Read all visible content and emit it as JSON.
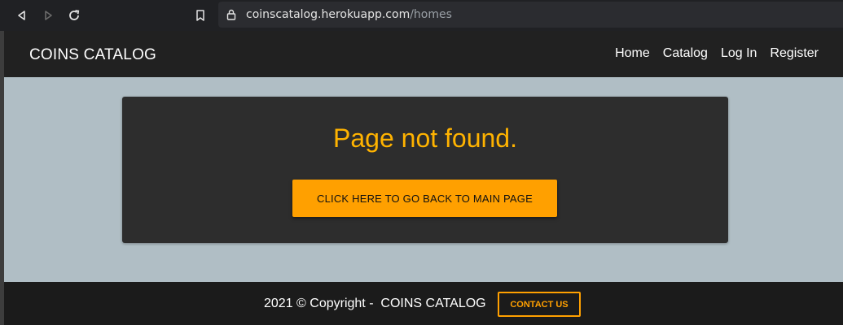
{
  "browser": {
    "url_host": "coinscatalog.herokuapp.com",
    "url_path": "/homes",
    "icons": [
      "back-icon",
      "forward-icon",
      "reload-icon",
      "bookmark-icon",
      "lock-icon"
    ]
  },
  "header": {
    "brand": "COINS CATALOG",
    "nav": [
      "Home",
      "Catalog",
      "Log In",
      "Register"
    ]
  },
  "main": {
    "title": "Page not found.",
    "button_label": "CLICK HERE TO GO BACK TO MAIN PAGE"
  },
  "footer": {
    "copyright": "2021 © Copyright -  COINS CATALOG",
    "contact_label": "CONTACT US"
  },
  "colors": {
    "header_bg": "#212121",
    "main_bg": "#b0bec5",
    "card_bg": "#2d2d2d",
    "accent": "#ffa000",
    "title": "#ffb300"
  }
}
